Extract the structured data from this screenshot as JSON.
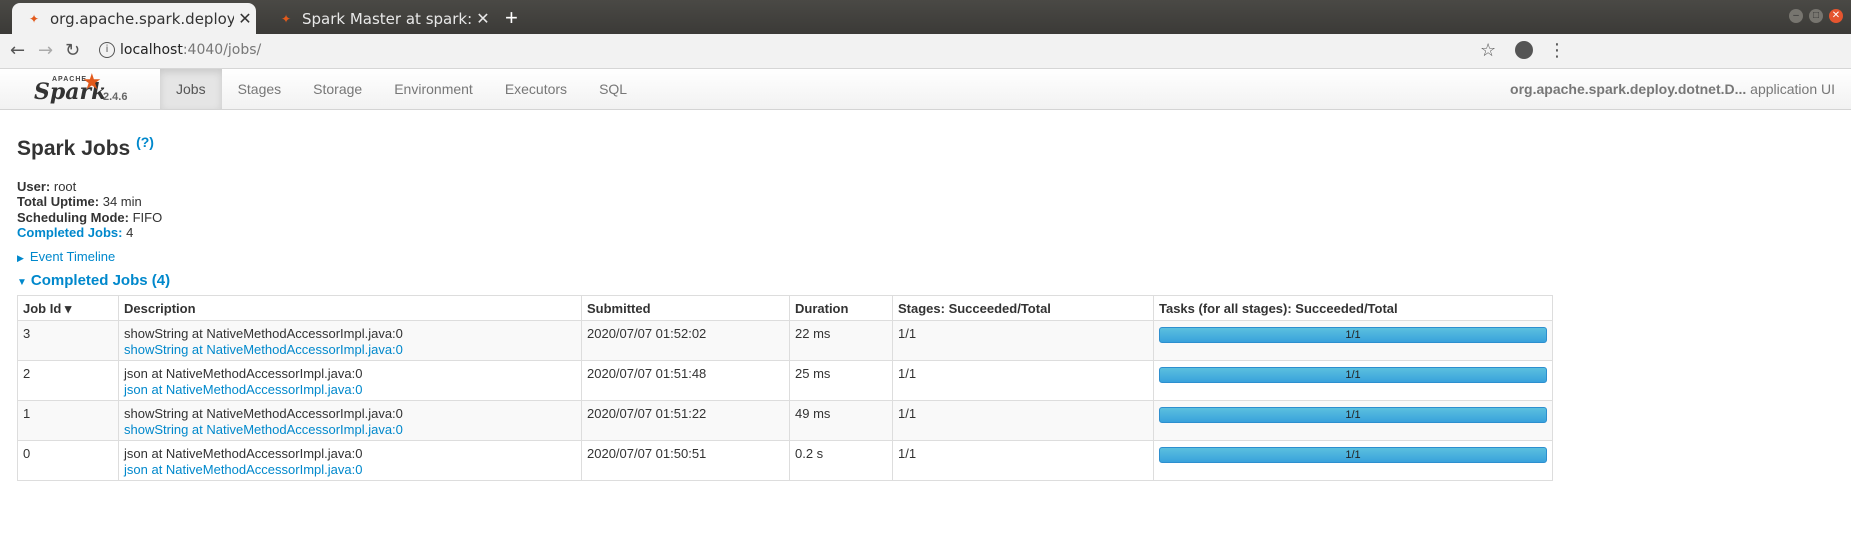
{
  "browser": {
    "tabs": [
      {
        "title": "org.apache.spark.deploy.",
        "icon": "spark-favicon",
        "active": true
      },
      {
        "title": "Spark Master at spark://u",
        "icon": "spark-favicon",
        "active": false
      }
    ],
    "url_host": "localhost",
    "url_path": ":4040/jobs/"
  },
  "spark_nav": {
    "version": "2.4.6",
    "tabs": [
      "Jobs",
      "Stages",
      "Storage",
      "Environment",
      "Executors",
      "SQL"
    ],
    "app_name": "org.apache.spark.deploy.dotnet.D...",
    "app_suffix": "application UI"
  },
  "page": {
    "title": "Spark Jobs",
    "help": "(?)",
    "user_label": "User:",
    "user": "root",
    "uptime_label": "Total Uptime:",
    "uptime": "34 min",
    "sched_label": "Scheduling Mode:",
    "sched": "FIFO",
    "completed_label": "Completed Jobs:",
    "completed": "4",
    "event_timeline": "Event Timeline",
    "completed_header": "Completed Jobs (4)"
  },
  "table": {
    "headers": [
      "Job Id ▾",
      "Description",
      "Submitted",
      "Duration",
      "Stages: Succeeded/Total",
      "Tasks (for all stages): Succeeded/Total"
    ],
    "rows": [
      {
        "id": "3",
        "desc": "showString at NativeMethodAccessorImpl.java:0",
        "link": "showString at NativeMethodAccessorImpl.java:0",
        "submitted": "2020/07/07 01:52:02",
        "duration": "22 ms",
        "stages": "1/1",
        "tasks": "1/1"
      },
      {
        "id": "2",
        "desc": "json at NativeMethodAccessorImpl.java:0",
        "link": "json at NativeMethodAccessorImpl.java:0",
        "submitted": "2020/07/07 01:51:48",
        "duration": "25 ms",
        "stages": "1/1",
        "tasks": "1/1"
      },
      {
        "id": "1",
        "desc": "showString at NativeMethodAccessorImpl.java:0",
        "link": "showString at NativeMethodAccessorImpl.java:0",
        "submitted": "2020/07/07 01:51:22",
        "duration": "49 ms",
        "stages": "1/1",
        "tasks": "1/1"
      },
      {
        "id": "0",
        "desc": "json at NativeMethodAccessorImpl.java:0",
        "link": "json at NativeMethodAccessorImpl.java:0",
        "submitted": "2020/07/07 01:50:51",
        "duration": "0.2 s",
        "stages": "1/1",
        "tasks": "1/1"
      }
    ]
  },
  "colors": {
    "accent": "#0088cc",
    "progress": "#39a2dc",
    "spark_orange": "#e25a1c"
  }
}
